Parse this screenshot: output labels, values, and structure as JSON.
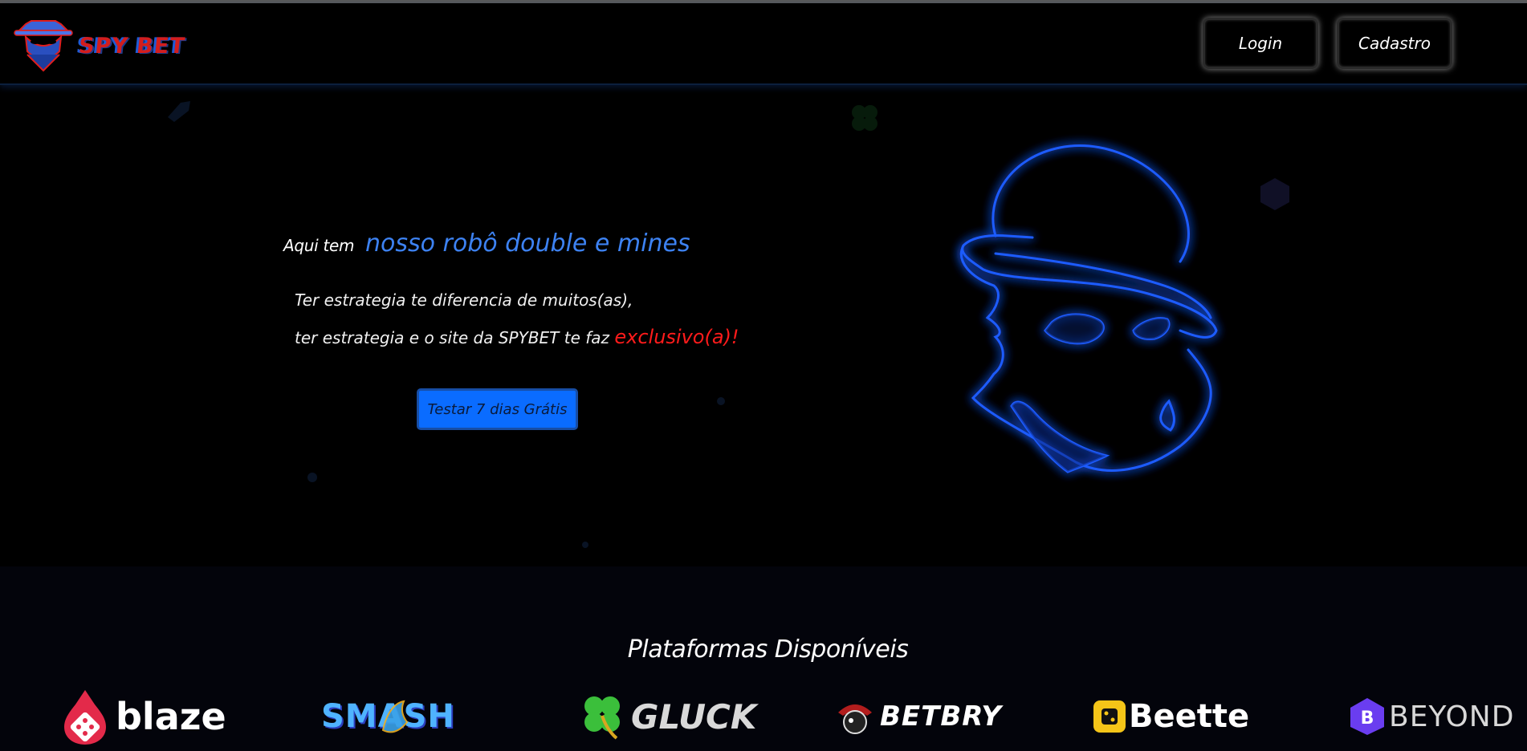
{
  "header": {
    "brand": "SPY BET",
    "login_label": "Login",
    "register_label": "Cadastro"
  },
  "hero": {
    "lead": "Aqui tem",
    "accent": "nosso robô double e mines",
    "line1": "Ter estrategia te diferencia de muitos(as),",
    "line2": "ter estrategia e o site da SPYBET te faz",
    "highlight": "exclusivo(a)!",
    "cta_label": "Testar 7 dias Grátis"
  },
  "platforms": {
    "title": "Plataformas Disponíveis",
    "items": [
      {
        "name": "blaze",
        "icon": "blaze-dice-icon"
      },
      {
        "name": "SMASH",
        "icon": "shark-icon"
      },
      {
        "name": "GLUCK",
        "icon": "clover-icon"
      },
      {
        "name": "BETBRY",
        "icon": "pirate-icon"
      },
      {
        "name": "Beette",
        "icon": "dice-square-icon"
      },
      {
        "name": "BEYOND",
        "icon": "b-hexagon-icon"
      }
    ]
  },
  "colors": {
    "accent_blue": "#3d82f2",
    "cta_blue": "#0a6cff",
    "highlight_red": "#ff1b1b",
    "neon_blue": "#1f5bff"
  }
}
